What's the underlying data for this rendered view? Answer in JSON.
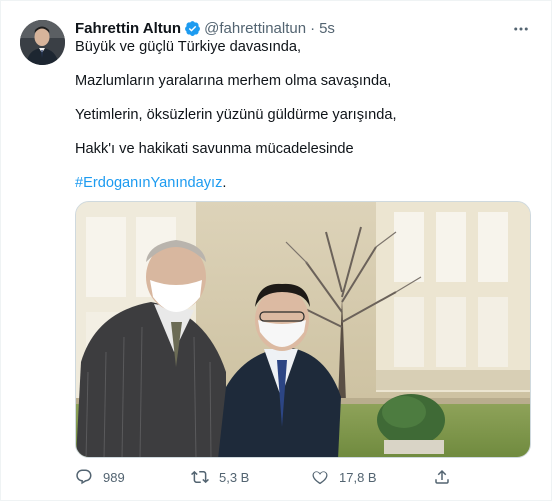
{
  "tweet": {
    "author_name": "Fahrettin Altun",
    "author_handle": "@fahrettinaltun",
    "separator": "·",
    "time": "5s",
    "paragraphs": [
      "Büyük ve güçlü Türkiye davasında,",
      "Mazlumların yaralarına merhem olma savaşında,",
      "Yetimlerin, öksüzlerin yüzünü güldürme yarışında,",
      "Hakk'ı ve hakikati savunma mücadelesinde"
    ],
    "hashtag": "#ErdoganınYanındayız",
    "hashtag_suffix": "."
  },
  "actions": {
    "reply_count": "989",
    "retweet_count": "5,3 B",
    "like_count": "17,8 B"
  },
  "icons": {
    "verified": "verified-badge-icon",
    "more": "more-options-icon",
    "reply": "reply-icon",
    "retweet": "retweet-icon",
    "like": "heart-icon",
    "share": "share-icon"
  },
  "colors": {
    "text": "#0f1419",
    "secondary": "#536471",
    "accent": "#1d9bf0",
    "border": "#eff3f4"
  }
}
